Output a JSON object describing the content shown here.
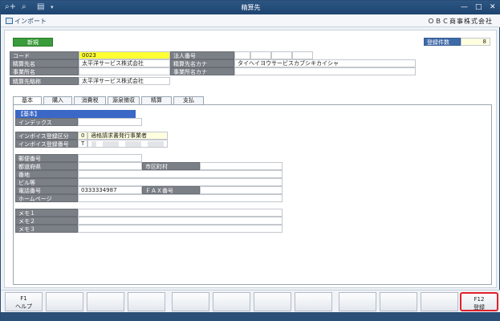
{
  "window": {
    "title": "精算先",
    "quick_access": [
      "⌕+",
      "⌕",
      "▤",
      "▾"
    ],
    "controls": [
      "—",
      "□",
      "✕"
    ]
  },
  "ribbon": {
    "import_label": "インポート",
    "company": "ＯＢＣ商事株式会社"
  },
  "header": {
    "new_button": "新規",
    "count_label": "登録件数",
    "count_value": "8"
  },
  "fields": {
    "code_label": "コード",
    "code_value": "0023",
    "name_label": "精算先名",
    "name_value": "太平洋サービス株式会社",
    "office_label": "事業所名",
    "office_value": "",
    "short_label": "精算先略称",
    "short_value": "太平洋サービス株式会社",
    "corp_label": "法人番号",
    "kana_label": "精算先名カナ",
    "kana_value": "タイヘイヨウサービスカブシキカイシャ",
    "office_kana_label": "事業所名カナ",
    "office_kana_value": ""
  },
  "tabs": [
    "基本",
    "購入",
    "消費税",
    "源泉徴収",
    "精算",
    "支払"
  ],
  "basic": {
    "section": "【基本】",
    "index_label": "インデックス",
    "invoice_class_label": "インボイス登録区分",
    "invoice_class_code": "0",
    "invoice_class_name": "適格請求書発行事業者",
    "invoice_no_label": "インボイス登録番号",
    "invoice_no_prefix": "T",
    "zip_label": "郵便番号",
    "pref_label": "都道府県",
    "city_label": "市区町村",
    "banchi_label": "番地",
    "building_label": "ビル等",
    "phone_label": "電話番号",
    "phone_value": "0333334987",
    "fax_label": "ＦＡＸ番号",
    "homepage_label": "ホームページ",
    "memo1_label": "メモ１",
    "memo2_label": "メモ２",
    "memo3_label": "メモ３"
  },
  "fkeys": {
    "f1_num": "F1",
    "f1_label": "ヘルプ",
    "f12_num": "F12",
    "f12_label": "登録"
  }
}
